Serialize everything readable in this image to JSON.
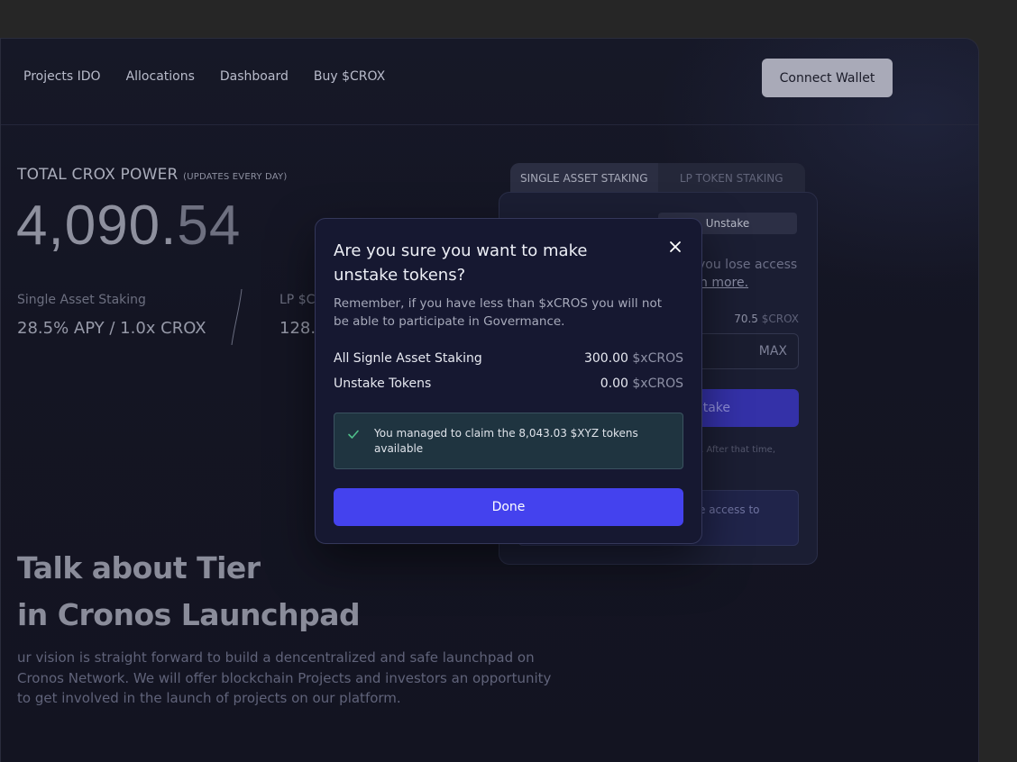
{
  "nav": {
    "links": [
      "Projects IDO",
      "Allocations",
      "Dashboard",
      "Buy $CROX"
    ],
    "connect_label": "Connect Wallet"
  },
  "power": {
    "title": "TOTAL CROX POWER",
    "subtitle": "(UPDATES EVERY DAY)",
    "value_int": "4,090.",
    "value_dec": "54"
  },
  "stats": {
    "single_label": "Single Asset Staking",
    "single_value": "28.5% APY / 1.0x CROX",
    "lp_label": "LP $C",
    "lp_value": "128.5"
  },
  "tier": {
    "title_line1": "Talk about Tier",
    "title_line2": "in Cronos Launchpad",
    "description": "ur vision is straight forward to build a dencentralized and safe launchpad on Cronos Network. We will offer blockchain Projects and investors an opportunity to get involved in the launch of projects on our platform."
  },
  "staking_card": {
    "tab_single": "SINGLE ASSET STAKING",
    "tab_lp": "LP TOKEN STAKING",
    "toggle_label": "Unstake",
    "text_line1": "you lose access",
    "text_link": "n more.",
    "balance_value": "70.5",
    "balance_unit": "$CROX",
    "max_label": "MAX",
    "button_label": "stake",
    "note": ". After that time,",
    "info_text": "e access to"
  },
  "modal": {
    "title": "Are you sure you want to make unstake tokens?",
    "description": "Remember, if you have less than $xCROS you will not be able to participate in Govermance.",
    "rows": [
      {
        "label": "All Signle Asset Staking",
        "value": "300.00",
        "unit": "$xCROS"
      },
      {
        "label": "Unstake Tokens",
        "value": "0.00",
        "unit": "$xCROS"
      }
    ],
    "alert_text": "You managed to claim the 8,043.03 $XYZ tokens available",
    "done_label": "Done"
  },
  "colors": {
    "accent": "#4442ee",
    "success": "#4fbf8a"
  }
}
